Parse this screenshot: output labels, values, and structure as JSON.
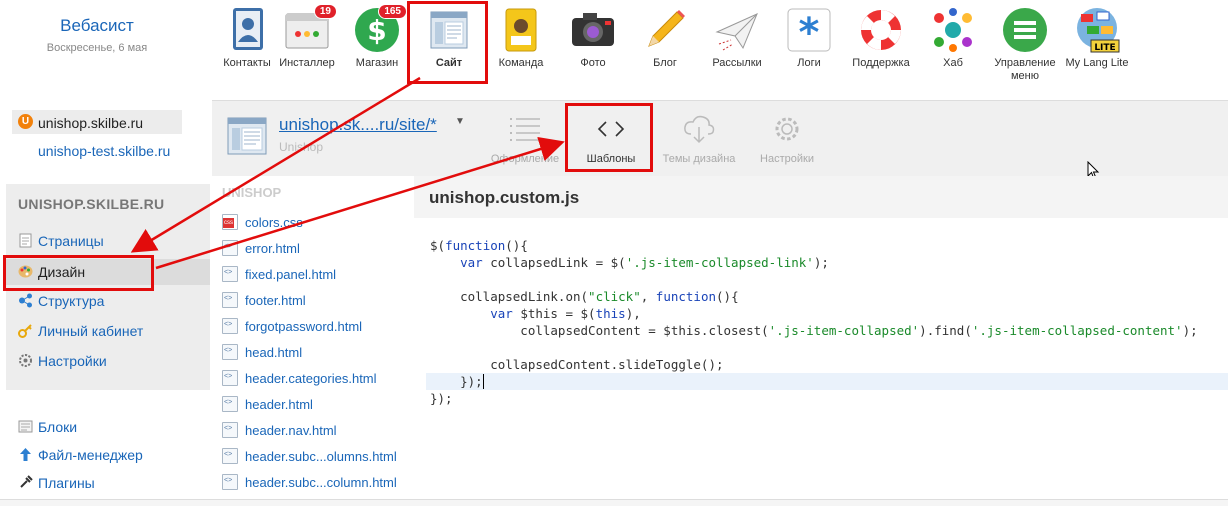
{
  "header": {
    "brand_name": "Вебасист",
    "brand_date": "Воскресенье, 6 мая",
    "apps": [
      {
        "label": "Контакты",
        "icon": "contacts-icon"
      },
      {
        "label": "Инсталлер",
        "icon": "installer-icon",
        "badge": "19"
      },
      {
        "label": "Магазин",
        "icon": "shop-icon",
        "badge": "165"
      },
      {
        "label": "Сайт",
        "icon": "site-icon"
      },
      {
        "label": "Команда",
        "icon": "team-icon"
      },
      {
        "label": "Фото",
        "icon": "camera-icon"
      },
      {
        "label": "Блог",
        "icon": "pencil-icon"
      },
      {
        "label": "Рассылки",
        "icon": "paper-plane-icon"
      },
      {
        "label": "Логи",
        "icon": "asterisk-icon"
      },
      {
        "label": "Поддержка",
        "icon": "lifebuoy-icon"
      },
      {
        "label": "Хаб",
        "icon": "hub-icon"
      },
      {
        "label": "Управление меню",
        "icon": "menu-icon"
      },
      {
        "label": "My Lang Lite",
        "icon": "globe-flags-icon"
      }
    ]
  },
  "sidebar": {
    "domains": [
      "unishop.skilbe.ru",
      "unishop-test.skilbe.ru"
    ],
    "site_title": "UNISHOP.SKILBE.RU",
    "nav": [
      {
        "label": "Страницы",
        "icon": "page-icon"
      },
      {
        "label": "Дизайн",
        "icon": "palette-icon",
        "active": true
      },
      {
        "label": "Структура",
        "icon": "structure-icon"
      },
      {
        "label": "Личный кабинет",
        "icon": "key-icon"
      },
      {
        "label": "Настройки",
        "icon": "gear-icon"
      }
    ],
    "extra": [
      {
        "label": "Блоки",
        "icon": "blocks-icon"
      },
      {
        "label": "Файл-менеджер",
        "icon": "upload-arrow-icon"
      },
      {
        "label": "Плагины",
        "icon": "plugin-icon"
      }
    ]
  },
  "main": {
    "site_link": "unishop.sk....ru/site/*",
    "site_sub": "Unishop",
    "tools": [
      {
        "label": "Оформление",
        "icon": "list-icon"
      },
      {
        "label": "Шаблоны",
        "icon": "code-icon",
        "active": true
      },
      {
        "label": "Темы дизайна",
        "icon": "cloud-download-icon"
      },
      {
        "label": "Настройки",
        "icon": "gear-icon"
      }
    ],
    "filelist_title": "UNISHOP",
    "files": [
      "colors.css",
      "error.html",
      "fixed.panel.html",
      "footer.html",
      "forgotpassword.html",
      "head.html",
      "header.categories.html",
      "header.html",
      "header.nav.html",
      "header.subc...olumns.html",
      "header.subc...column.html"
    ],
    "editor_title": "unishop.custom.js"
  },
  "colors": {
    "accent": "#1a66b8",
    "annotation": "#e20c0c"
  }
}
